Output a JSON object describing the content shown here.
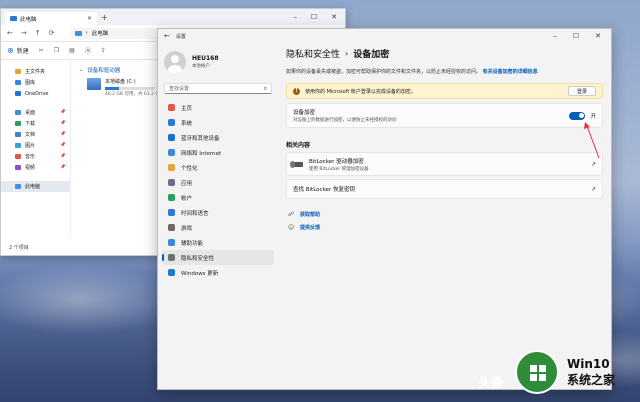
{
  "explorer": {
    "tab_title": "此电脑",
    "path_label": "此电脑",
    "new_label": "新建",
    "nav_items": [
      {
        "label": "主文件夹",
        "color": "#e8a33b",
        "pinned": false
      },
      {
        "label": "图库",
        "color": "#3b8ad9",
        "pinned": false
      },
      {
        "label": "OneDrive",
        "color": "#1c7ad4",
        "pinned": false
      },
      {
        "label": "桌面",
        "color": "#3f8ee8",
        "pinned": true
      },
      {
        "label": "下载",
        "color": "#2aa05a",
        "pinned": true
      },
      {
        "label": "文档",
        "color": "#4a7bd0",
        "pinned": true
      },
      {
        "label": "图片",
        "color": "#3aa0d8",
        "pinned": true
      },
      {
        "label": "音乐",
        "color": "#e0574a",
        "pinned": true
      },
      {
        "label": "视频",
        "color": "#8a4fd8",
        "pinned": true
      },
      {
        "label": "此电脑",
        "color": "#3f8ee8",
        "pinned": false
      }
    ],
    "group_label": "设备和驱动器",
    "drive_name": "本地磁盘 (C:)",
    "drive_size": "46.2 GB 可用，共 63.2 GB",
    "drive_used_fraction": 0.27,
    "status_text": "2 个项目"
  },
  "settings": {
    "window_title": "设置",
    "user_name": "HEU168",
    "user_sub": "本地帐户",
    "search_placeholder": "查找设置",
    "nav": [
      {
        "label": "主页",
        "color": "#e0574a"
      },
      {
        "label": "系统",
        "color": "#2a7ad4"
      },
      {
        "label": "蓝牙和其他设备",
        "color": "#1c6fd0"
      },
      {
        "label": "网络和 Internet",
        "color": "#3b8ad9"
      },
      {
        "label": "个性化",
        "color": "#e8a33b"
      },
      {
        "label": "应用",
        "color": "#6b6b8a"
      },
      {
        "label": "帐户",
        "color": "#2aa05a"
      },
      {
        "label": "时间和语言",
        "color": "#2a7ad4"
      },
      {
        "label": "游戏",
        "color": "#6b6b6b"
      },
      {
        "label": "辅助功能",
        "color": "#3b8ad9"
      },
      {
        "label": "隐私和安全性",
        "color": "#707070"
      },
      {
        "label": "Windows 更新",
        "color": "#1c7ad4"
      }
    ],
    "active_nav_index": 10,
    "breadcrumb_parent": "隐私和安全性",
    "breadcrumb_sep": "›",
    "breadcrumb_current": "设备加密",
    "description": "如果你的设备丢失或被盗，加密可帮助保护你的文件和文件夹，以防止未经授权的访问。",
    "description_link": "有关设备加密的详细信息",
    "banner_text": "使用你的 Microsoft 帐户登录以完成设备的加密。",
    "banner_button": "登录",
    "encryption_title": "设备加密",
    "encryption_sub": "对设备上的数据进行加密，以便防止未经授权的访问",
    "toggle_state": "开",
    "related_title": "相关内容",
    "bitlocker_title": "BitLocker 驱动器加密",
    "bitlocker_sub": "使用 BitLocker 管理加密设备",
    "recovery_title": "查找 BitLocker 恢复密钥",
    "help_label": "获取帮助",
    "feedback_label": "提供反馈"
  },
  "watermark": {
    "prefix": "头条",
    "title": "Win10",
    "subtitle": "系统之家"
  },
  "colors": {
    "accent": "#005fb8",
    "banner_bg": "#fff4ce"
  }
}
